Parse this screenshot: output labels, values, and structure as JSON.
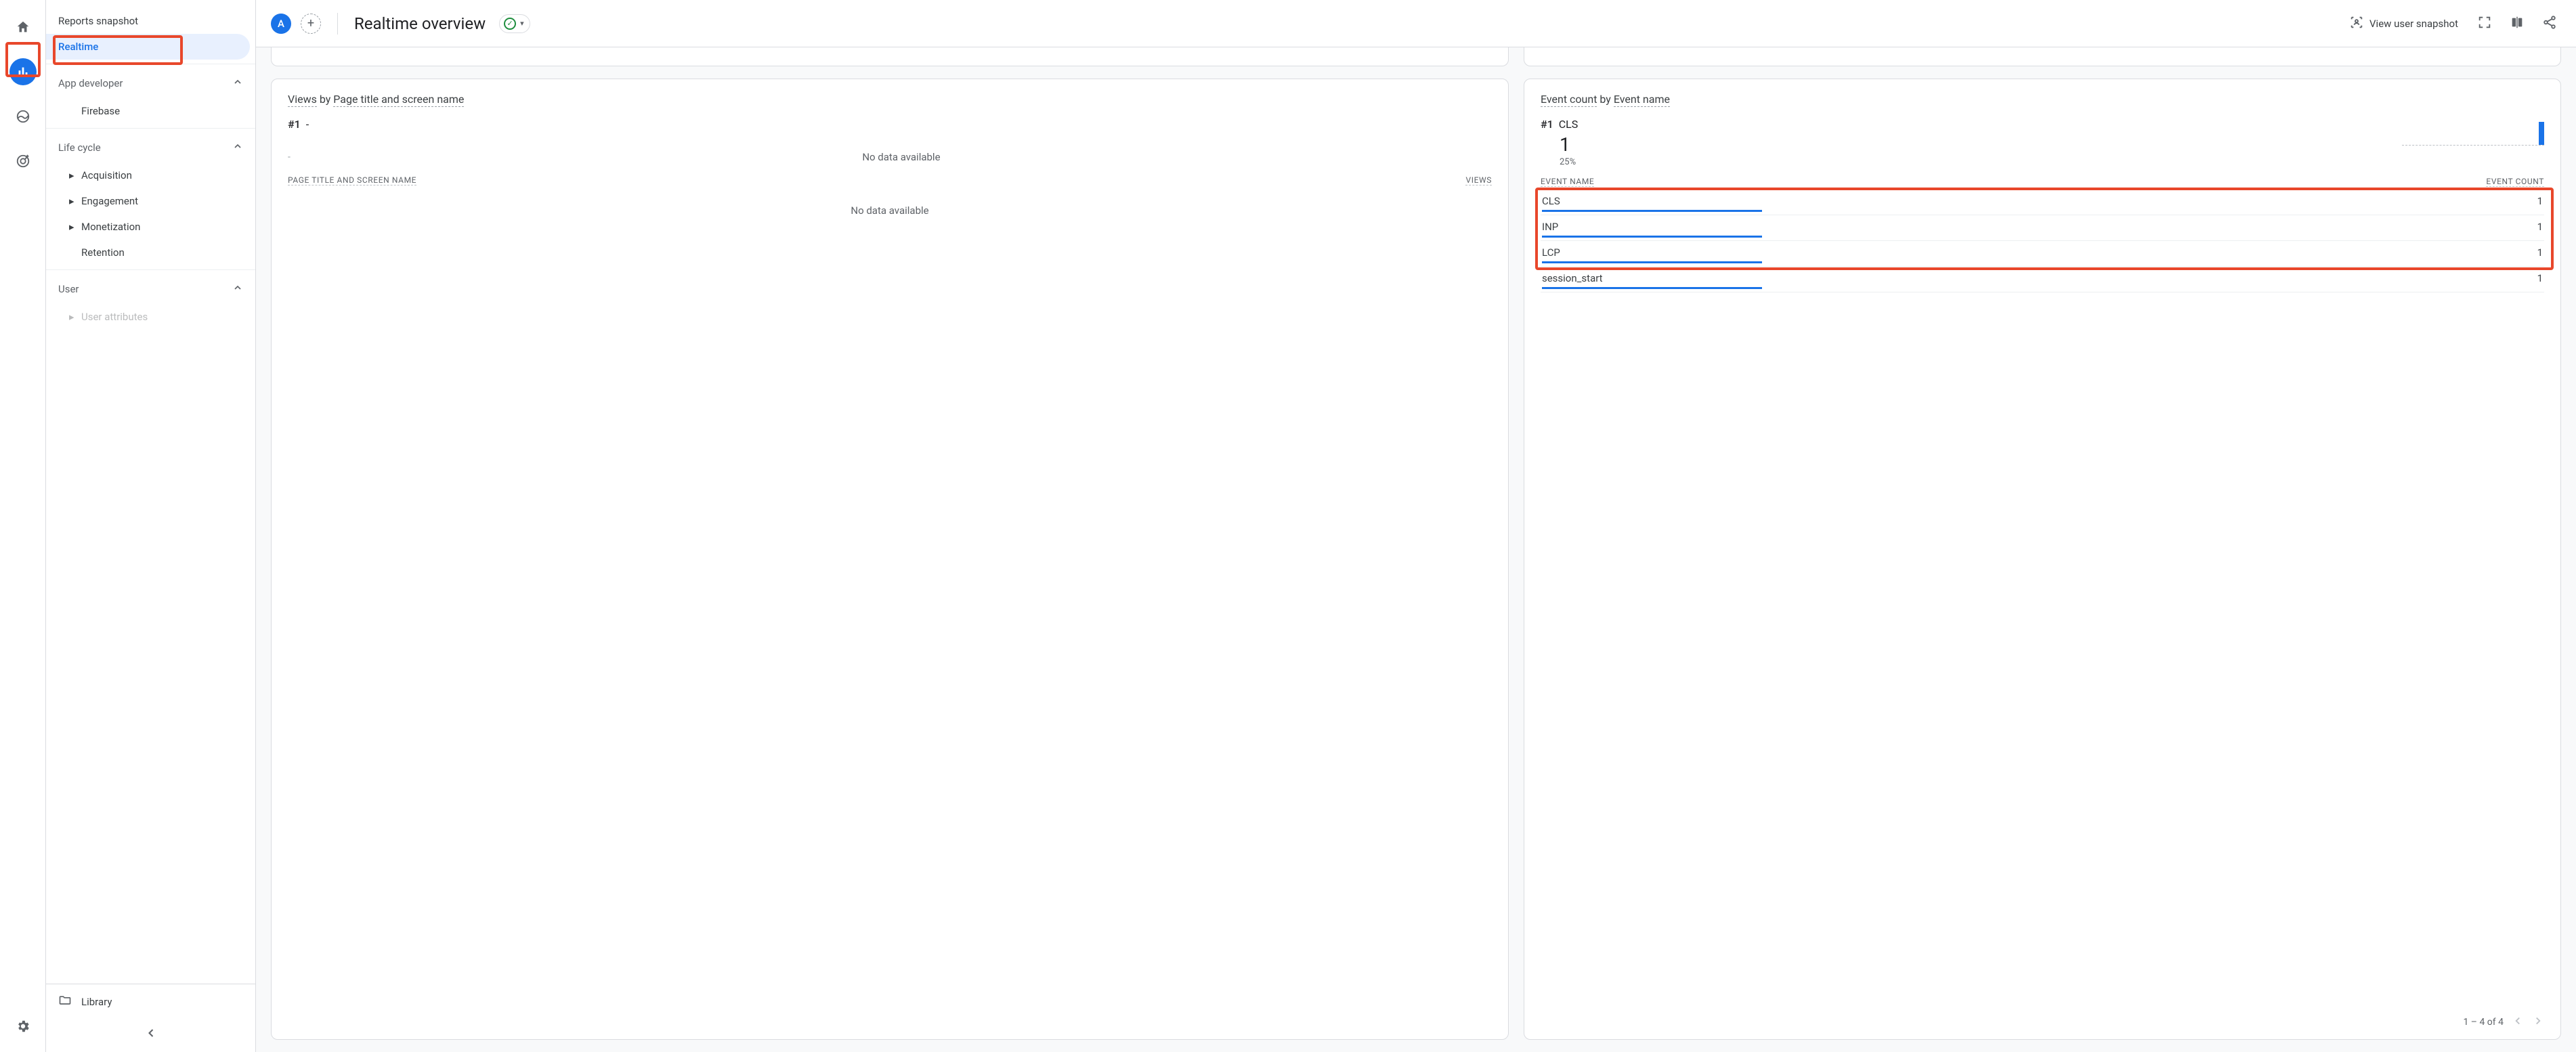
{
  "rail": {
    "items": [
      "home",
      "reports",
      "explore",
      "advertising"
    ],
    "active": "reports",
    "settings": "settings"
  },
  "sidebar": {
    "reports_snapshot": "Reports snapshot",
    "realtime": "Realtime",
    "groups": [
      {
        "label": "App developer",
        "items": [
          {
            "label": "Firebase",
            "has_caret": false
          }
        ]
      },
      {
        "label": "Life cycle",
        "items": [
          {
            "label": "Acquisition",
            "has_caret": true
          },
          {
            "label": "Engagement",
            "has_caret": true
          },
          {
            "label": "Monetization",
            "has_caret": true
          },
          {
            "label": "Retention",
            "has_caret": false
          }
        ]
      },
      {
        "label": "User",
        "items": [
          {
            "label": "User attributes",
            "has_caret": true
          }
        ]
      }
    ],
    "library": "Library"
  },
  "header": {
    "segment_chip": "A",
    "title": "Realtime overview",
    "snapshot_btn": "View user snapshot"
  },
  "views_card": {
    "title_metric": "Views",
    "title_by": "by",
    "title_dim": "Page title and screen name",
    "rank": "#1",
    "rank_value": "-",
    "nodata_row": "-",
    "nodata_right": "No data available",
    "col1": "PAGE TITLE AND SCREEN NAME",
    "col2": "VIEWS",
    "nodata_body": "No data available"
  },
  "events_card": {
    "title_metric": "Event count",
    "title_by": "by",
    "title_dim": "Event name",
    "rank": "#1",
    "rank_value": "CLS",
    "big_value": "1",
    "pct": "25%",
    "col1": "EVENT NAME",
    "col2": "EVENT COUNT",
    "rows": [
      {
        "name": "CLS",
        "count": "1",
        "bar_pct": 22
      },
      {
        "name": "INP",
        "count": "1",
        "bar_pct": 22
      },
      {
        "name": "LCP",
        "count": "1",
        "bar_pct": 22
      },
      {
        "name": "session_start",
        "count": "1",
        "bar_pct": 22
      }
    ],
    "pager": "1 – 4 of 4"
  },
  "chart_data": {
    "type": "bar",
    "title": "Event count by Event name",
    "xlabel": "Event name",
    "ylabel": "Event count",
    "categories": [
      "CLS",
      "INP",
      "LCP",
      "session_start"
    ],
    "values": [
      1,
      1,
      1,
      1
    ],
    "ylim": [
      0,
      1
    ]
  }
}
